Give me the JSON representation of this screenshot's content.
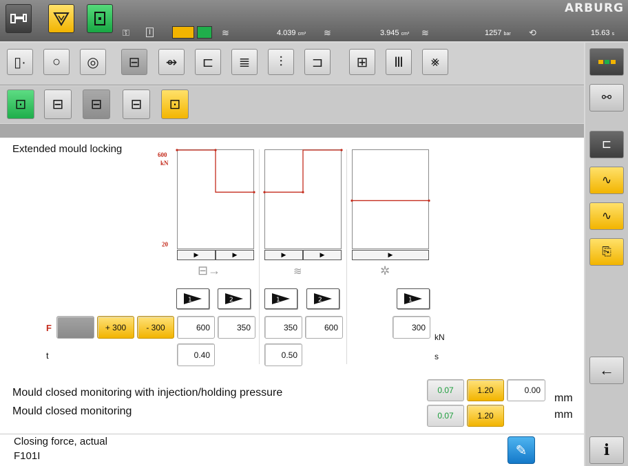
{
  "header": {
    "brand": "ARBURG",
    "readouts": [
      {
        "value": "4.039",
        "unit": "cm³"
      },
      {
        "value": "3.945",
        "unit": "cm³"
      },
      {
        "value": "1257",
        "unit": "bar"
      },
      {
        "value": "15.63",
        "unit": "s"
      }
    ]
  },
  "main": {
    "title": "Extended mould locking",
    "chart": {
      "y_max_label": "600",
      "y_unit_label": "kN",
      "y_min_label": "20"
    },
    "row_f_label": "F",
    "row_t_label": "t",
    "quick_buttons": [
      {
        "label": "+ 300"
      },
      {
        "label": "- 300"
      }
    ],
    "forces": [
      "600",
      "350",
      "350",
      "600",
      "300"
    ],
    "force_unit": "kN",
    "times": [
      "0.40",
      "0.50"
    ],
    "time_unit": "s",
    "monitoring": {
      "row1_label": "Mould closed monitoring with injection/holding pressure",
      "row2_label": "Mould closed monitoring",
      "row1_values": [
        "0.07",
        "1.20",
        "0.00"
      ],
      "row2_values": [
        "0.07",
        "1.20"
      ],
      "unit": "mm"
    }
  },
  "footer": {
    "line1": "Closing force, actual",
    "line2": "F101I"
  },
  "sidebar": {
    "info_label": "i",
    "back_label": "←"
  },
  "colors": {
    "accent_yellow": "#f2b400",
    "accent_green": "#1fae4b",
    "curve_red": "#c42b1c"
  },
  "chart_data": [
    {
      "type": "line",
      "series": [
        {
          "values": [
            600,
            350
          ]
        }
      ]
    },
    {
      "type": "line",
      "series": [
        {
          "values": [
            350,
            600
          ]
        }
      ]
    },
    {
      "type": "line",
      "series": [
        {
          "values": [
            300
          ]
        }
      ]
    }
  ]
}
